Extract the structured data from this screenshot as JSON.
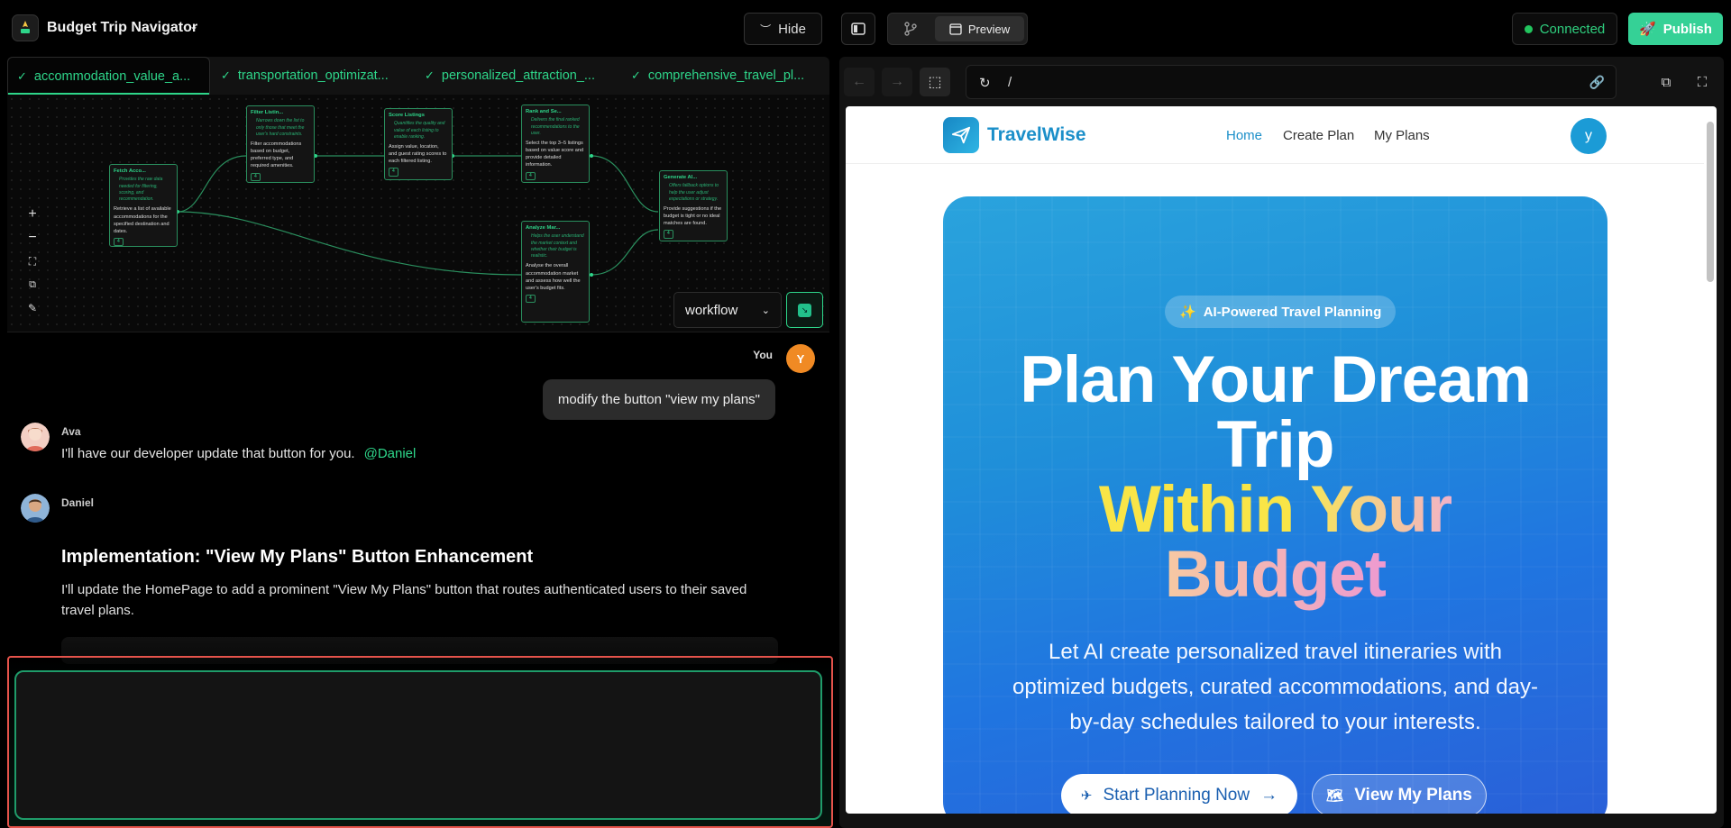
{
  "app": {
    "title": "Budget Trip Navigator",
    "hide_label": "Hide",
    "preview_label": "Preview",
    "connected_label": "Connected",
    "publish_label": "Publish"
  },
  "tabs": [
    {
      "label": "accommodation_value_a..."
    },
    {
      "label": "transportation_optimizat..."
    },
    {
      "label": "personalized_attraction_..."
    },
    {
      "label": "comprehensive_travel_pl..."
    }
  ],
  "workflow": {
    "nodes": [
      {
        "title": "Fetch Acco...",
        "desc": "Provides the raw data needed for filtering, scoring, and recommendation.",
        "body": "Retrieve a list of available accommodations for the specified destination and dates.",
        "tag": "4"
      },
      {
        "title": "Filter Listin...",
        "desc": "Narrows down the list to only those that meet the user's hard constraints.",
        "body": "Filter accommodations based on budget, preferred type, and required amenities.",
        "tag": "4"
      },
      {
        "title": "Score Listings",
        "desc": "Quantifies the quality and value of each listing to enable ranking.",
        "body": "Assign value, location, and guest rating scores to each filtered listing.",
        "tag": "4"
      },
      {
        "title": "Rank and Se...",
        "desc": "Delivers the final ranked recommendations to the user.",
        "body": "Select the top 3–5 listings based on value score and provide detailed information.",
        "tag": "4"
      },
      {
        "title": "Analyze Mar...",
        "desc": "Helps the user understand the market context and whether their budget is realistic.",
        "body": "Analyse the overall accommodation market and assess how well the user's budget fits.",
        "tag": "4"
      },
      {
        "title": "Generate Al...",
        "desc": "Offers fallback options to help the user adjust expectations or strategy.",
        "body": "Provide suggestions if the budget is tight or no ideal matches are found.",
        "tag": "4"
      }
    ],
    "select_value": "workflow"
  },
  "chat": {
    "you_label": "You",
    "you_initial": "Y",
    "you_message": "modify the button \"view my plans\"",
    "ava_name": "Ava",
    "ava_message": "I'll have our developer update that button for you.",
    "ava_mention": "@Daniel",
    "daniel_name": "Daniel",
    "impl_title": "Implementation: \"View My Plans\" Button Enhancement",
    "impl_desc": "I'll update the HomePage to add a prominent \"View My Plans\" button that routes authenticated users to their saved travel plans.",
    "input_value": ""
  },
  "browser": {
    "url": "/"
  },
  "site": {
    "brand": "TravelWise",
    "nav": [
      "Home",
      "Create Plan",
      "My Plans"
    ],
    "user_initial": "y",
    "badge": "AI-Powered Travel Planning",
    "title_line1": "Plan Your Dream",
    "title_line2": "Trip",
    "title_line3a": "Within",
    "title_line3b": "Your",
    "title_line4": "Budget",
    "subtitle": "Let AI create personalized travel itineraries with optimized budgets, curated accommodations, and day-by-day schedules tailored to your interests.",
    "cta_primary": "Start Planning Now",
    "cta_secondary": "View My Plans"
  },
  "colors": {
    "accent_green": "#2ed68a",
    "publish": "#35d196",
    "brand_blue": "#1b8fc9",
    "highlight_red": "#e5534b"
  }
}
